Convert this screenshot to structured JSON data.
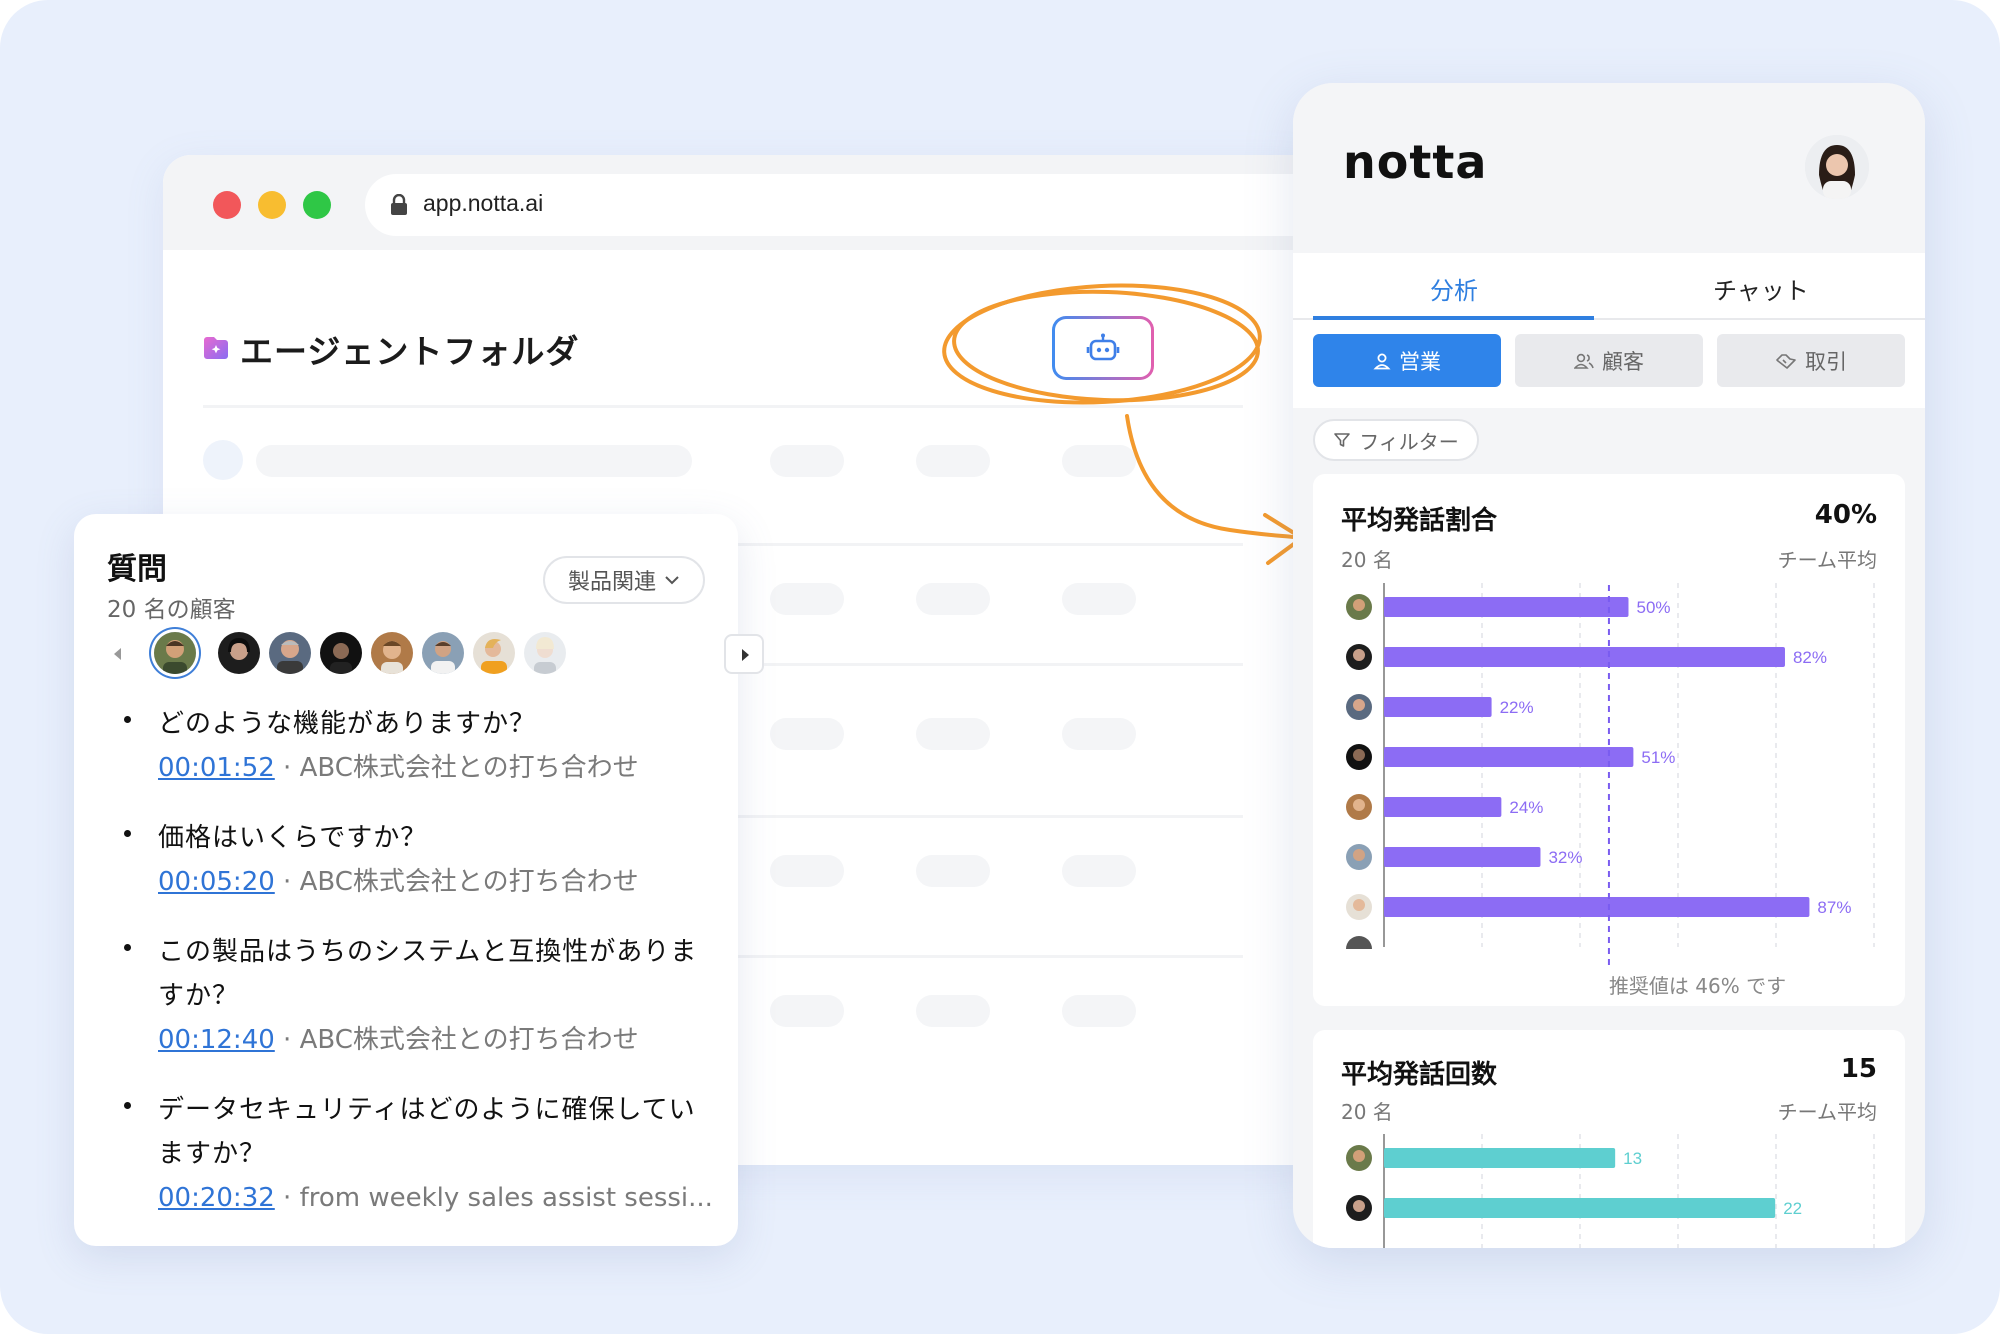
{
  "browser": {
    "url": "app.notta.ai",
    "folder_title": "エージェントフォルダ"
  },
  "questions": {
    "title": "質問",
    "subtitle": "20 名の顧客",
    "filter_label": "製品関連",
    "items": [
      {
        "text": "どのような機能がありますか？",
        "time": "00:01:52",
        "source": " · ABC株式会社との打ち合わせ"
      },
      {
        "text": "価格はいくらですか？",
        "time": "00:05:20",
        "source": " · ABC株式会社との打ち合わせ"
      },
      {
        "text": "この製品はうちのシステムと互換性がありますか？",
        "time": "00:12:40",
        "source": " · ABC株式会社との打ち合わせ"
      },
      {
        "text": "データセキュリティはどのように確保していますか？",
        "time": "00:20:32",
        "source": " · from weekly sales assist sessi..."
      }
    ]
  },
  "panel": {
    "logo": "notta",
    "tabs": [
      "分析",
      "チャット"
    ],
    "segments": [
      "営業",
      "顧客",
      "取引"
    ],
    "filter_label": "フィルター",
    "accent": "#2f84ea"
  },
  "chart_data": [
    {
      "type": "bar",
      "title": "平均発話割合",
      "value": "40%",
      "subtitle": "20 名",
      "subtitle_right": "チーム平均",
      "orientation": "horizontal",
      "values": [
        50,
        82,
        22,
        51,
        24,
        32,
        87
      ],
      "value_labels": [
        "50%",
        "82%",
        "22%",
        "51%",
        "24%",
        "32%",
        "87%"
      ],
      "xlim": [
        0,
        100
      ],
      "reference_line": 46,
      "reference_label": "推奨値は 46% です",
      "color": "#8c6cf4"
    },
    {
      "type": "bar",
      "title": "平均発話回数",
      "value": "15",
      "subtitle": "20 名",
      "subtitle_right": "チーム平均",
      "orientation": "horizontal",
      "values": [
        13,
        22
      ],
      "value_labels": [
        "13",
        "22"
      ],
      "xlim": [
        0,
        27.5
      ],
      "color": "#5ecfd0"
    }
  ]
}
